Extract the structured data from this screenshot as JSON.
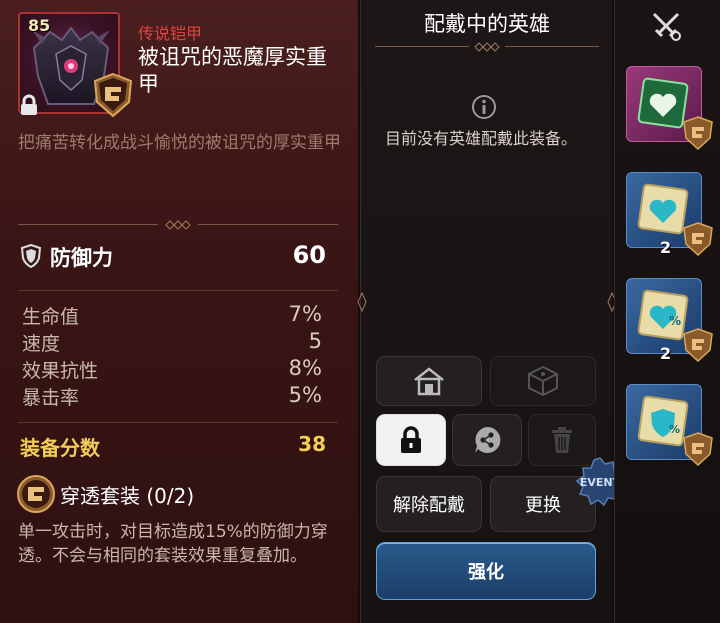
{
  "item": {
    "level": "85",
    "rarity": "传说铠甲",
    "name": "被诅咒的恶魔厚实重甲",
    "description": "把痛苦转化成战斗愉悦的被诅咒的厚实重甲"
  },
  "main_stat": {
    "label": "防御力",
    "value": "60"
  },
  "substats": [
    {
      "label": "生命值",
      "value": "7%"
    },
    {
      "label": "速度",
      "value": "5"
    },
    {
      "label": "效果抗性",
      "value": "8%"
    },
    {
      "label": "暴击率",
      "value": "5%"
    }
  ],
  "score": {
    "label": "装备分数",
    "value": "38"
  },
  "set": {
    "title": "穿透套装 (0/2)",
    "description": "单一攻击时，对目标造成15%的防御力穿透。不会与相同的套装效果重复叠加。"
  },
  "equipped": {
    "title": "配戴中的英雄",
    "message": "目前没有英雄配戴此装备。"
  },
  "buttons": {
    "unequip": "解除配戴",
    "replace": "更换",
    "enhance": "强化"
  },
  "event_badge": "EVENT",
  "slots": [
    {
      "color": "green",
      "count": ""
    },
    {
      "color": "cyan",
      "count": "2"
    },
    {
      "color": "cyan",
      "count": "2"
    },
    {
      "color": "cyan",
      "count": ""
    }
  ],
  "colors": {
    "rarity": "#e0453e",
    "score": "#f3cd55",
    "enhance_button": "#2a5a8a",
    "panel_bg": "#3a1515"
  },
  "icons": {
    "lock": "lock-icon",
    "shield": "shield-icon",
    "set": "penetration-set-icon",
    "info": "info-icon",
    "house": "storage-icon",
    "dice": "dice-icon",
    "share": "share-icon",
    "trash": "trash-icon",
    "swords": "crossed-swords-icon"
  }
}
